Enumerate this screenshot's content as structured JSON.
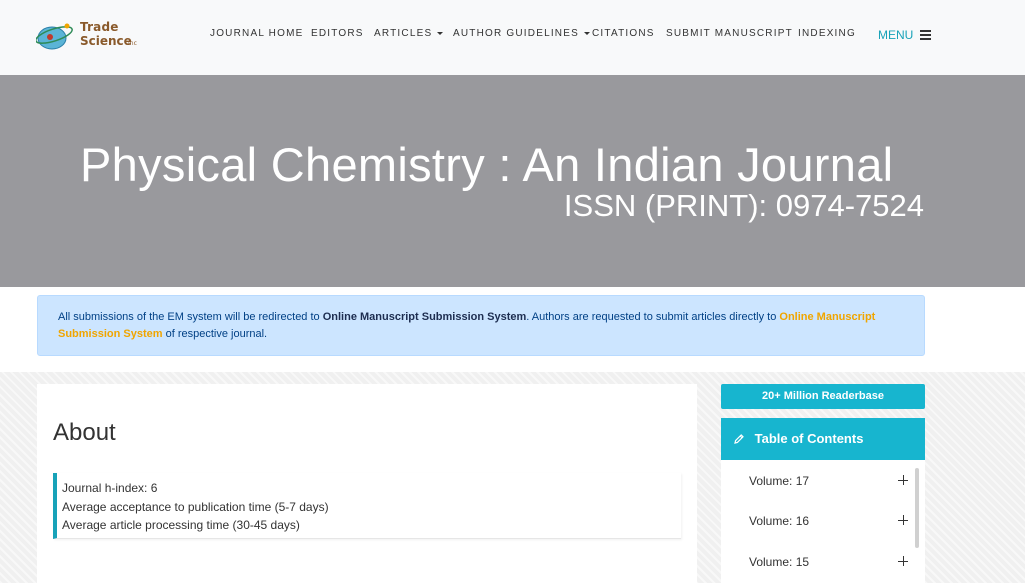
{
  "header": {
    "logo": {
      "line1": "Trade",
      "line2": "Science",
      "line3": "Inc"
    },
    "nav": [
      {
        "label": "JOURNAL HOME",
        "dropdown": false
      },
      {
        "label": "EDITORS",
        "dropdown": false
      },
      {
        "label": "ARTICLES",
        "dropdown": true
      },
      {
        "label": "AUTHOR GUIDELINES",
        "dropdown": true
      },
      {
        "label": "CITATIONS",
        "dropdown": false
      },
      {
        "label": "SUBMIT MANUSCRIPT",
        "dropdown": false
      },
      {
        "label": "INDEXING",
        "dropdown": false
      }
    ],
    "menu_label": "MENU"
  },
  "banner": {
    "title": "Physical Chemistry : An Indian Journal",
    "issn": "ISSN (PRINT): 0974-7524"
  },
  "notice": {
    "text1": "All submissions of the EM system will be redirected to ",
    "bold": "Online Manuscript Submission System",
    "text2": ". Authors are requested to submit articles directly to ",
    "link": "Online Manuscript Submission System",
    "text3": " of respective journal."
  },
  "about": {
    "title": "About",
    "metrics": [
      "Journal h-index: 6",
      "Average acceptance to publication time (5-7 days)",
      "Average article processing time (30-45 days)"
    ]
  },
  "sidebar": {
    "readerbase": "20+ Million Readerbase",
    "toc_title": "Table of Contents",
    "volumes": [
      "Volume: 17",
      "Volume: 16",
      "Volume: 15"
    ]
  },
  "colors": {
    "accent": "#17b5cf",
    "banner": "#99999d",
    "notice_bg": "#cce5ff",
    "link": "#f0a500"
  }
}
